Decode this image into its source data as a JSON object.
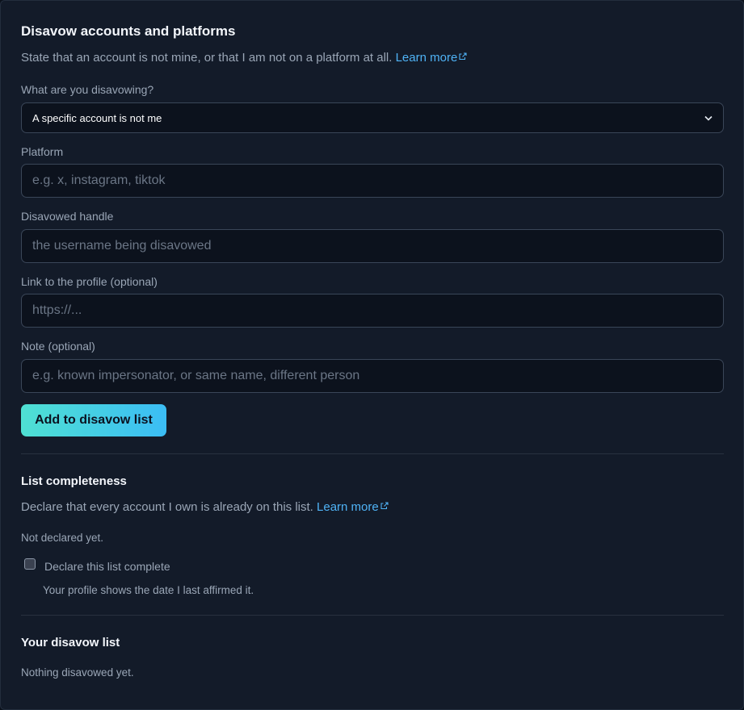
{
  "disavow": {
    "title": "Disavow accounts and platforms",
    "description": "State that an account is not mine, or that I am not on a platform at all.",
    "learn_more": "Learn more",
    "type_label": "What are you disavowing?",
    "type_value": "A specific account is not me",
    "platform_label": "Platform",
    "platform_placeholder": "e.g. x, instagram, tiktok",
    "handle_label": "Disavowed handle",
    "handle_placeholder": "the username being disavowed",
    "link_label": "Link to the profile (optional)",
    "link_placeholder": "https://...",
    "note_label": "Note (optional)",
    "note_placeholder": "e.g. known impersonator, or same name, different person",
    "add_button": "Add to disavow list"
  },
  "completeness": {
    "title": "List completeness",
    "description": "Declare that every account I own is already on this list.",
    "learn_more": "Learn more",
    "status": "Not declared yet.",
    "checkbox_label": "Declare this list complete",
    "checkbox_checked": false,
    "hint": "Your profile shows the date I last affirmed it."
  },
  "list": {
    "title": "Your disavow list",
    "empty": "Nothing disavowed yet."
  },
  "colors": {
    "background": "#131b29",
    "accent_link": "#4fb3f6",
    "button_gradient_start": "#4fe0d3",
    "button_gradient_end": "#3bbdf5"
  },
  "icons": {
    "external_link": "external-link-icon",
    "select_chevron": "chevron-down-icon"
  }
}
